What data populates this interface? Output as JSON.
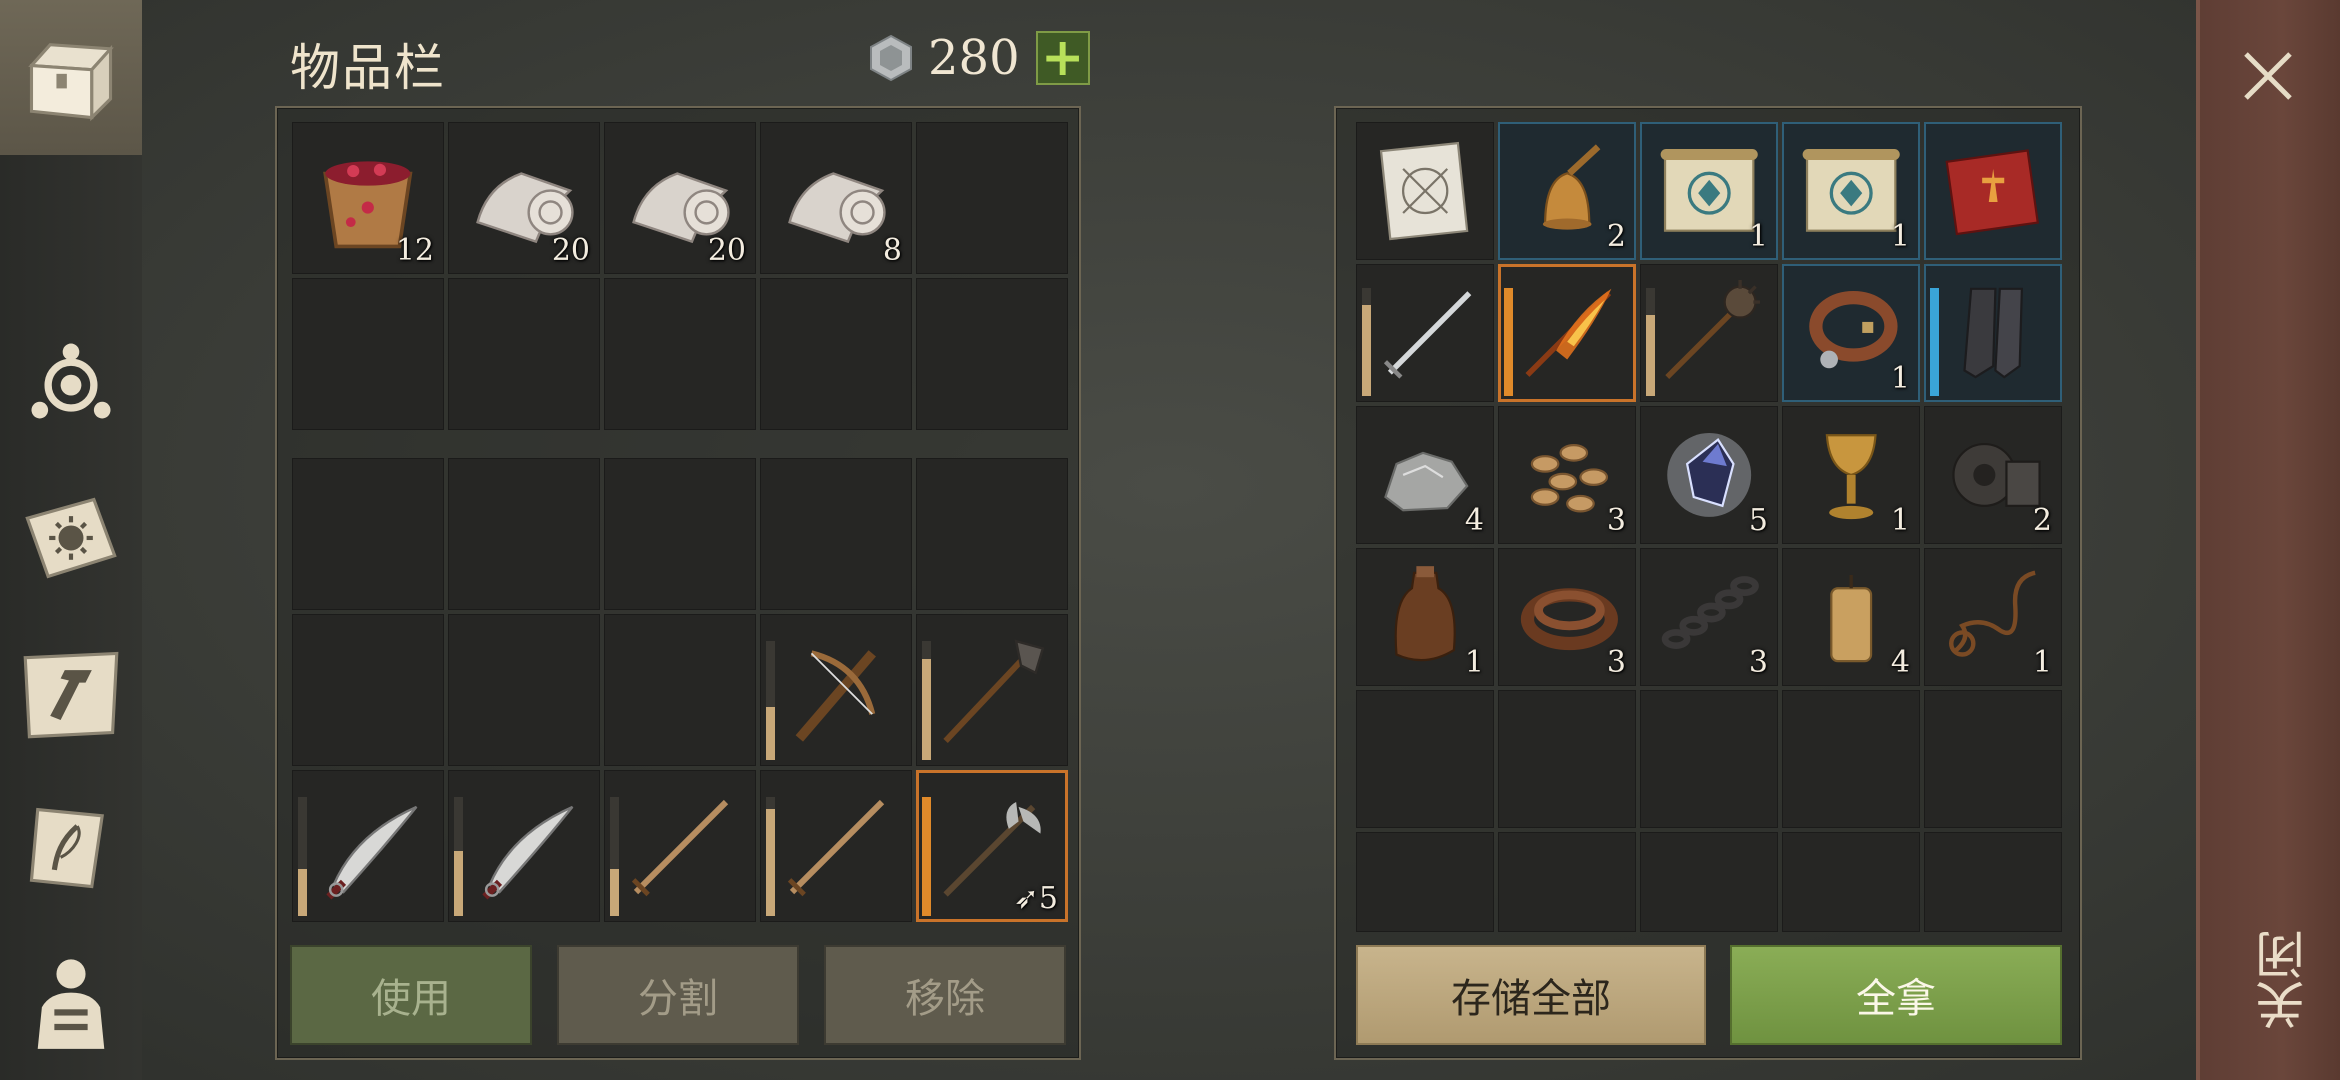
{
  "inventory": {
    "title": "物品栏",
    "currency_value": "280",
    "currency_icon": "silver-coin-icon",
    "add_button_icon": "plus-icon",
    "top_slots": [
      {
        "icon": "berry-bucket-icon",
        "qty": "12"
      },
      {
        "icon": "cloth-roll-icon",
        "qty": "20"
      },
      {
        "icon": "cloth-roll-icon",
        "qty": "20"
      },
      {
        "icon": "cloth-roll-icon",
        "qty": "8"
      },
      {
        "icon": "",
        "qty": ""
      },
      {
        "icon": "",
        "qty": ""
      },
      {
        "icon": "",
        "qty": ""
      },
      {
        "icon": "",
        "qty": ""
      },
      {
        "icon": "",
        "qty": ""
      },
      {
        "icon": "",
        "qty": ""
      }
    ],
    "bottom_slots": [
      {
        "icon": "",
        "qty": ""
      },
      {
        "icon": "",
        "qty": ""
      },
      {
        "icon": "",
        "qty": ""
      },
      {
        "icon": "",
        "qty": ""
      },
      {
        "icon": "",
        "qty": ""
      },
      {
        "icon": "",
        "qty": ""
      },
      {
        "icon": "",
        "qty": ""
      },
      {
        "icon": "",
        "qty": ""
      },
      {
        "icon": "crossbow-icon",
        "qty": "",
        "durability": 0.45
      },
      {
        "icon": "mace-staff-icon",
        "qty": "",
        "durability": 0.85
      },
      {
        "icon": "scimitar-icon",
        "qty": "",
        "durability": 0.4
      },
      {
        "icon": "scimitar-icon",
        "qty": "",
        "durability": 0.55
      },
      {
        "icon": "sword-icon",
        "qty": "",
        "durability": 0.4
      },
      {
        "icon": "sword-icon",
        "qty": "",
        "durability": 0.9
      },
      {
        "icon": "halberd-icon",
        "qty": "5",
        "durability": 1.0,
        "highlight": "orange",
        "qty_icon": "arrow-icon"
      }
    ],
    "buttons": {
      "use": "使用",
      "split": "分割",
      "remove": "移除"
    }
  },
  "container": {
    "slots": [
      {
        "icon": "blueprint-icon",
        "qty": ""
      },
      {
        "icon": "bell-icon",
        "qty": "2",
        "highlight": "blue"
      },
      {
        "icon": "rune-scroll-icon",
        "qty": "1",
        "highlight": "blue"
      },
      {
        "icon": "rune-scroll-icon",
        "qty": "1",
        "highlight": "blue"
      },
      {
        "icon": "red-book-icon",
        "qty": "",
        "highlight": "blue"
      },
      {
        "icon": "longsword-icon",
        "qty": "",
        "durability": 0.85
      },
      {
        "icon": "flame-sword-icon",
        "qty": "",
        "durability": 1.0,
        "highlight": "orange"
      },
      {
        "icon": "morning-star-icon",
        "qty": "",
        "durability": 0.75
      },
      {
        "icon": "leather-collar-icon",
        "qty": "1",
        "highlight": "blue"
      },
      {
        "icon": "chain-greaves-icon",
        "qty": "",
        "durability": 1.0,
        "highlight": "blue"
      },
      {
        "icon": "stone-ore-icon",
        "qty": "4"
      },
      {
        "icon": "seeds-icon",
        "qty": "3"
      },
      {
        "icon": "crystal-icon",
        "qty": "5"
      },
      {
        "icon": "goblet-icon",
        "qty": "1"
      },
      {
        "icon": "gear-icon",
        "qty": "2"
      },
      {
        "icon": "leather-flask-icon",
        "qty": "1"
      },
      {
        "icon": "leather-strap-icon",
        "qty": "3"
      },
      {
        "icon": "chain-icon",
        "qty": "3"
      },
      {
        "icon": "candle-icon",
        "qty": "4"
      },
      {
        "icon": "rope-icon",
        "qty": "1"
      },
      {
        "icon": "",
        "qty": ""
      },
      {
        "icon": "",
        "qty": ""
      },
      {
        "icon": "",
        "qty": ""
      },
      {
        "icon": "",
        "qty": ""
      },
      {
        "icon": "",
        "qty": ""
      },
      {
        "icon": "",
        "qty": ""
      },
      {
        "icon": "",
        "qty": ""
      },
      {
        "icon": "",
        "qty": ""
      },
      {
        "icon": "",
        "qty": ""
      },
      {
        "icon": "",
        "qty": ""
      }
    ],
    "buttons": {
      "store_all": "存储全部",
      "take_all": "全拿"
    }
  },
  "nav": [
    {
      "icon": "chest-icon",
      "active": true
    },
    {
      "icon": "character-skills-icon"
    },
    {
      "icon": "sun-book-icon"
    },
    {
      "icon": "crafting-map-icon"
    },
    {
      "icon": "quest-scroll-icon"
    },
    {
      "icon": "character-equipment-icon"
    }
  ],
  "close": {
    "label": "关闭",
    "icon": "close-icon"
  },
  "colors": {
    "accent_green": "#7f9b46",
    "rarity_blue": "#2f5f78",
    "rarity_orange": "#c9732a"
  }
}
